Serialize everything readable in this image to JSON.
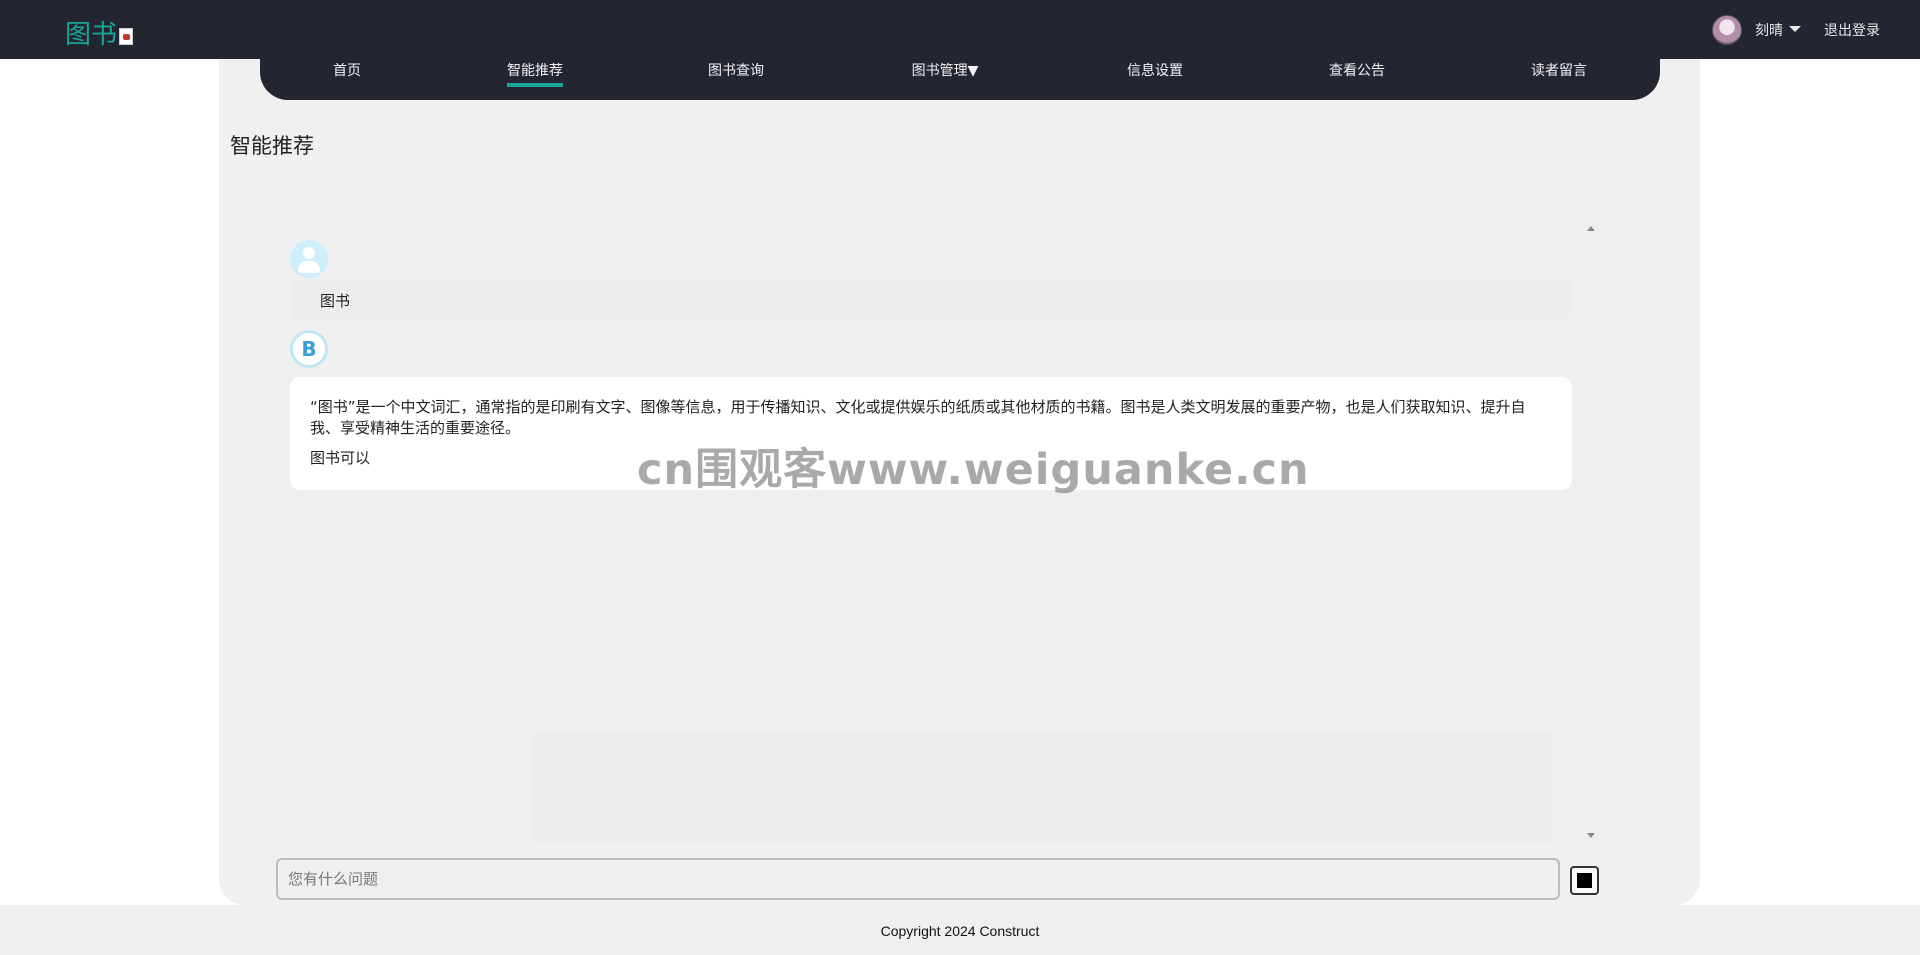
{
  "brand": {
    "title": "图书"
  },
  "header": {
    "user_name": "刻晴",
    "logout_label": "退出登录"
  },
  "nav": {
    "items": [
      {
        "label": "首页"
      },
      {
        "label": "智能推荐"
      },
      {
        "label": "图书查询"
      },
      {
        "label": "图书管理▼"
      },
      {
        "label": "信息设置"
      },
      {
        "label": "查看公告"
      },
      {
        "label": "读者留言"
      }
    ],
    "active_index": 1,
    "accent_color": "#19a59a"
  },
  "page": {
    "title": "智能推荐"
  },
  "chat": {
    "user_message": "图书",
    "bot_avatar_letter": "B",
    "bot_message": {
      "paragraph1": "“图书”是一个中文词汇，通常指的是印刷有文字、图像等信息，用于传播知识、文化或提供娱乐的纸质或其他材质的书籍。图书是人类文明发展的重要产物，也是人们获取知识、提升自我、享受精神生活的重要途径。",
      "paragraph2": "图书可以"
    }
  },
  "watermark": "cn围观客www.weiguanke.cn",
  "input": {
    "placeholder": "您有什么问题",
    "value": ""
  },
  "icons": {
    "user_avatar": "user-avatar-icon",
    "bot_avatar": "bot-avatar-icon",
    "send": "stop-square-icon",
    "dropdown": "caret-down-icon"
  },
  "footer": {
    "copyright": "Copyright 2024 Construct"
  }
}
